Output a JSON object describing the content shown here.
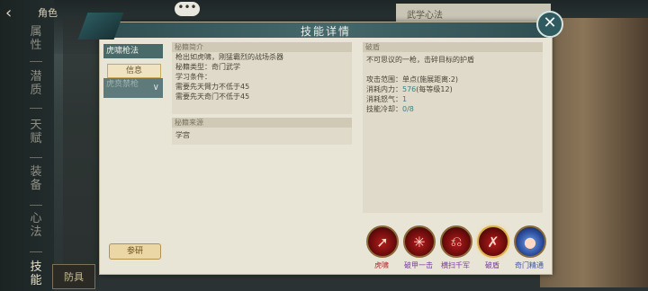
{
  "header": {
    "back_icon": "back-arrow-icon",
    "title": "角色"
  },
  "nav": {
    "items": [
      {
        "label": "属性"
      },
      {
        "label": "潜质"
      },
      {
        "label": "天赋"
      },
      {
        "label": "装备"
      },
      {
        "label": "心法"
      },
      {
        "label": "技能"
      }
    ],
    "active": "技能",
    "bottom_button": "防具"
  },
  "chat": {
    "label": "•••"
  },
  "behind_panel": {
    "title": "武学心法"
  },
  "dialog": {
    "title": "技能详情",
    "close_icon": "close-icon",
    "tabs": {
      "main": "虎啸枪法",
      "info": "信息",
      "dim": "虎贲禁枪"
    },
    "intro": {
      "header": "秘籍简介",
      "lines": [
        "枪出如虎啸，刚猛霸烈的战场杀器",
        "秘籍类型：奇门武学",
        "学习条件：",
        "需要先天臂力不低于45",
        "需要先天奇门不低于45"
      ]
    },
    "source": {
      "header": "秘籍来源",
      "lines": [
        "学宫"
      ]
    },
    "detail": {
      "header": "破盾",
      "desc": "不可思议的一枪，击碎目标的护盾",
      "range_label": "攻击范围：",
      "range_value": "单点(施展距离:2)",
      "power_label": "消耗内力：",
      "power_value": "576",
      "power_suffix": "(每等级12)",
      "rage_label": "消耗怒气：",
      "rage_value": "1",
      "cool_label": "技能冷却：",
      "cool_value": "0/8"
    },
    "skills": [
      {
        "label": "虎啸",
        "icon": "spear-strike-icon",
        "color": "red"
      },
      {
        "label": "破甲一击",
        "icon": "armor-break-icon",
        "color": "purple"
      },
      {
        "label": "横扫千军",
        "icon": "sweep-icon",
        "color": "purple"
      },
      {
        "label": "破盾",
        "icon": "shield-break-icon",
        "color": "purple",
        "selected": true
      },
      {
        "label": "奇门精通",
        "icon": "mastery-icon",
        "color": "blue"
      }
    ],
    "research_button": "参研"
  }
}
